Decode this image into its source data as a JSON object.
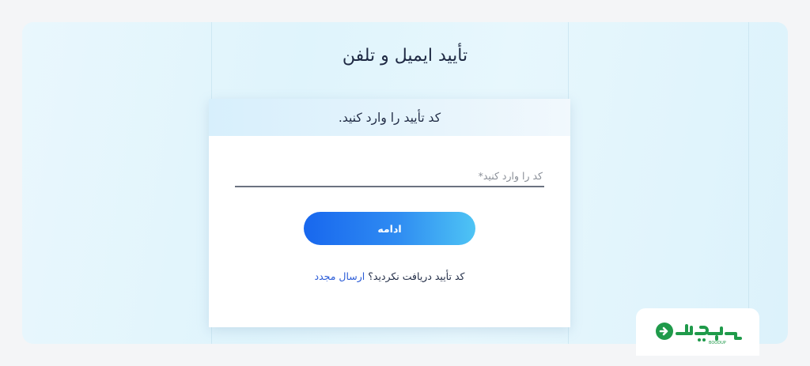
{
  "page": {
    "title": "تأیید ایمیل و تلفن"
  },
  "card": {
    "header": "کد تأیید را وارد کنید.",
    "code_input": {
      "placeholder": "کد را وارد کنید*",
      "value": ""
    },
    "continue_button": "ادامه",
    "resend": {
      "question": "کد تأیید دریافت نکردید؟",
      "link": "ارسال مجدد"
    }
  },
  "logo": {
    "caption": "BOODUP",
    "icon": "boodup-logo-icon"
  },
  "colors": {
    "accent_start": "#1867ee",
    "accent_end": "#4ec4f4",
    "link": "#2a5bd7",
    "logo_green": "#1f9a4a",
    "title_text": "#1f2a44"
  }
}
